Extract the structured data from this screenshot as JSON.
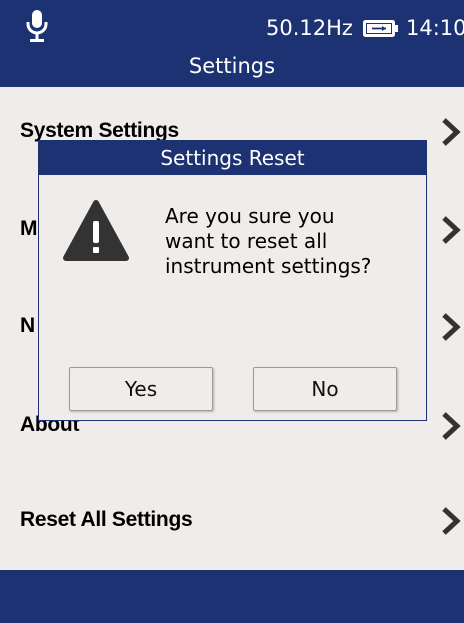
{
  "status_bar": {
    "mic_icon": "microphone-icon",
    "frequency": "50.12Hz",
    "battery_icon": "battery-charging-icon",
    "time": "14:10"
  },
  "header": {
    "title": "Settings"
  },
  "menu": {
    "items": [
      {
        "label": "System Settings",
        "icon": "chevron-right-icon"
      },
      {
        "label": "M",
        "icon": "chevron-right-icon"
      },
      {
        "label": "N",
        "icon": "chevron-right-icon"
      },
      {
        "label": "About",
        "icon": "chevron-right-icon"
      },
      {
        "label": "Reset All Settings",
        "icon": "chevron-right-icon"
      }
    ]
  },
  "dialog": {
    "title": "Settings Reset",
    "icon": "warning-icon",
    "message_lines": [
      "Are you sure you",
      "want to reset all",
      "instrument settings?"
    ],
    "yes_label": "Yes",
    "no_label": "No"
  },
  "colors": {
    "brand_navy": "#1d3272",
    "background": "#efecea"
  }
}
